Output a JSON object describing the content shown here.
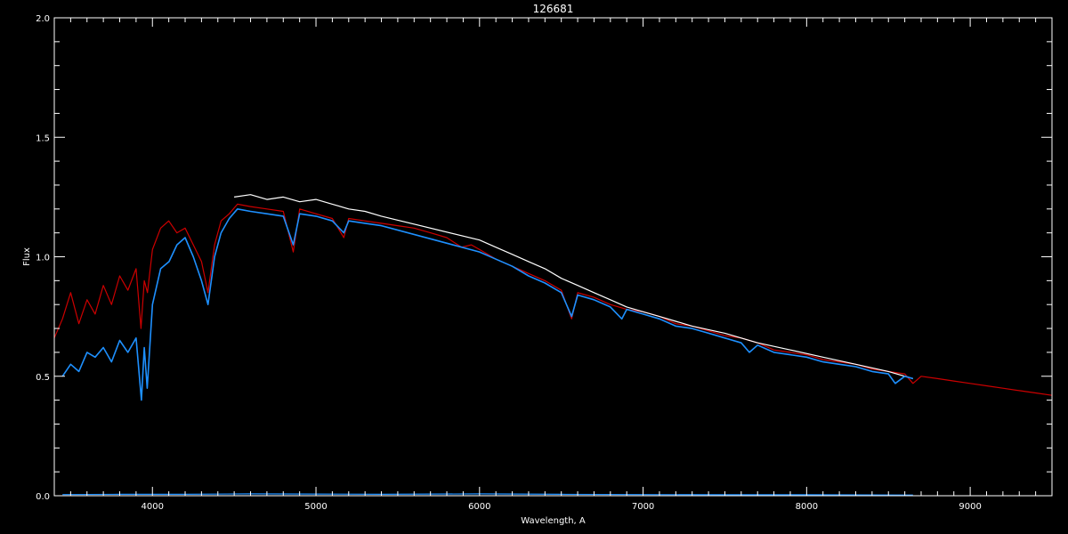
{
  "chart_data": {
    "type": "line",
    "title": "126681",
    "xlabel": "Wavelength, A",
    "ylabel": "Flux",
    "xlim": [
      3400,
      9500
    ],
    "ylim": [
      0.0,
      2.0
    ],
    "x_ticks": [
      4000,
      5000,
      6000,
      7000,
      8000,
      9000
    ],
    "x_tick_labels": [
      "4000",
      "5000",
      "6000",
      "7000",
      "8000",
      "9000"
    ],
    "y_ticks": [
      0.0,
      0.5,
      1.0,
      1.5,
      2.0
    ],
    "y_tick_labels": [
      "0.0",
      "0.5",
      "1.0",
      "1.5",
      "2.0"
    ],
    "background": "#000000",
    "grid": false,
    "series": [
      {
        "color": "#cc0000",
        "x": [
          3400,
          3450,
          3500,
          3550,
          3600,
          3650,
          3700,
          3750,
          3800,
          3850,
          3900,
          3930,
          3950,
          3970,
          4000,
          4050,
          4100,
          4150,
          4200,
          4250,
          4300,
          4340,
          4380,
          4420,
          4470,
          4520,
          4600,
          4700,
          4800,
          4861,
          4900,
          5000,
          5100,
          5170,
          5200,
          5300,
          5400,
          5500,
          5600,
          5700,
          5800,
          5890,
          5950,
          6000,
          6100,
          6200,
          6300,
          6400,
          6500,
          6563,
          6600,
          6700,
          6800,
          6900,
          7000,
          7100,
          7200,
          7300,
          7400,
          7500,
          7600,
          7700,
          7800,
          7900,
          8000,
          8100,
          8200,
          8300,
          8400,
          8500,
          8600,
          8650,
          8700,
          8800,
          8900,
          9000,
          9100,
          9200,
          9300,
          9400,
          9500
        ],
        "y": [
          0.66,
          0.74,
          0.85,
          0.72,
          0.82,
          0.76,
          0.88,
          0.8,
          0.92,
          0.86,
          0.95,
          0.7,
          0.9,
          0.85,
          1.03,
          1.12,
          1.15,
          1.1,
          1.12,
          1.05,
          0.98,
          0.85,
          1.05,
          1.15,
          1.18,
          1.22,
          1.21,
          1.2,
          1.19,
          1.02,
          1.2,
          1.18,
          1.16,
          1.08,
          1.16,
          1.15,
          1.14,
          1.13,
          1.12,
          1.1,
          1.08,
          1.04,
          1.05,
          1.03,
          0.99,
          0.96,
          0.93,
          0.9,
          0.86,
          0.74,
          0.85,
          0.83,
          0.8,
          0.78,
          0.77,
          0.75,
          0.72,
          0.71,
          0.69,
          0.67,
          0.66,
          0.64,
          0.61,
          0.6,
          0.59,
          0.57,
          0.56,
          0.55,
          0.53,
          0.52,
          0.51,
          0.47,
          0.5,
          0.49,
          0.48,
          0.47,
          0.46,
          0.45,
          0.44,
          0.43,
          0.42
        ]
      },
      {
        "color": "#ffffff",
        "x": [
          4500,
          4600,
          4700,
          4800,
          4900,
          5000,
          5100,
          5200,
          5300,
          5400,
          6000,
          6100,
          6200,
          6300,
          6400,
          6500,
          6600,
          6700,
          6800,
          6900,
          7000,
          7100,
          7200,
          7300,
          7500,
          7700,
          7900,
          8100,
          8300,
          8500,
          8650
        ],
        "y": [
          1.25,
          1.26,
          1.24,
          1.25,
          1.23,
          1.24,
          1.22,
          1.2,
          1.19,
          1.17,
          1.07,
          1.04,
          1.01,
          0.98,
          0.95,
          0.91,
          0.88,
          0.85,
          0.82,
          0.79,
          0.77,
          0.75,
          0.73,
          0.71,
          0.68,
          0.64,
          0.61,
          0.58,
          0.55,
          0.52,
          0.49
        ]
      },
      {
        "color": "#1e90ff",
        "x": [
          3450,
          3500,
          3550,
          3600,
          3650,
          3700,
          3750,
          3800,
          3850,
          3900,
          3933,
          3950,
          3968,
          4000,
          4050,
          4102,
          4150,
          4200,
          4250,
          4300,
          4340,
          4380,
          4420,
          4470,
          4520,
          4600,
          4700,
          4800,
          4861,
          4900,
          5000,
          5100,
          5170,
          5200,
          5300,
          5400,
          6000,
          6100,
          6200,
          6300,
          6400,
          6500,
          6563,
          6600,
          6700,
          6800,
          6870,
          6900,
          7000,
          7100,
          7200,
          7300,
          7400,
          7500,
          7600,
          7650,
          7700,
          7800,
          7900,
          8000,
          8100,
          8200,
          8300,
          8400,
          8500,
          8542,
          8600,
          8650
        ],
        "y": [
          0.5,
          0.55,
          0.52,
          0.6,
          0.58,
          0.62,
          0.56,
          0.65,
          0.6,
          0.66,
          0.4,
          0.62,
          0.45,
          0.8,
          0.95,
          0.98,
          1.05,
          1.08,
          1.0,
          0.9,
          0.8,
          1.0,
          1.1,
          1.16,
          1.2,
          1.19,
          1.18,
          1.17,
          1.05,
          1.18,
          1.17,
          1.15,
          1.1,
          1.15,
          1.14,
          1.13,
          1.02,
          0.99,
          0.96,
          0.92,
          0.89,
          0.85,
          0.75,
          0.84,
          0.82,
          0.79,
          0.74,
          0.78,
          0.76,
          0.74,
          0.71,
          0.7,
          0.68,
          0.66,
          0.64,
          0.6,
          0.63,
          0.6,
          0.59,
          0.58,
          0.56,
          0.55,
          0.54,
          0.52,
          0.51,
          0.47,
          0.5,
          0.49
        ]
      },
      {
        "color": "#1e90ff",
        "x": [
          3450,
          3800,
          4200,
          4600,
          5000,
          5400,
          6000,
          6500,
          7000,
          7500,
          8000,
          8650
        ],
        "y": [
          0.005,
          0.006,
          0.006,
          0.008,
          0.007,
          0.006,
          0.008,
          0.006,
          0.005,
          0.004,
          0.004,
          0.003
        ]
      }
    ]
  }
}
